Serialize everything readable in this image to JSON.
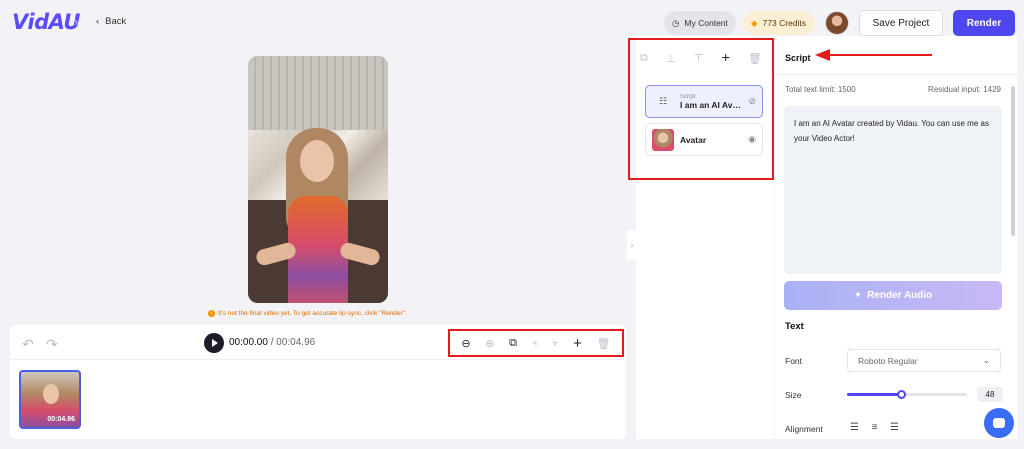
{
  "header": {
    "logo": "VidAU",
    "back_label": "Back",
    "my_content": "My Content",
    "credits": "773 Credits",
    "save_project": "Save Project",
    "render": "Render"
  },
  "preview": {
    "notice": "It's not the final video yet, To get accurate lip-sync, click \"Render\"."
  },
  "timeline": {
    "current_time": "00:00.00",
    "separator": " / ",
    "total_time": "00:04.96",
    "clip_duration": "00:04.96",
    "tools": [
      "zoom-out",
      "zoom-in",
      "copy",
      "split-left",
      "split-right",
      "add",
      "delete"
    ]
  },
  "layers": {
    "items": [
      {
        "type_label": "Script",
        "name": "I am an AI Ava...",
        "icon": "script-icon",
        "visibility": "hidden-eye-icon",
        "selected": true
      },
      {
        "type_label": "",
        "name": "Avatar",
        "icon": "avatar-thumb",
        "visibility": "eye-icon",
        "selected": false
      }
    ]
  },
  "script_panel": {
    "title": "Script",
    "total_limit": "Total text limit: 1500",
    "residual": "Residual input: 1429",
    "script_text": "I am an AI Avatar created by Vidau. You can use me as your Video Actor!",
    "render_audio": "Render Audio",
    "text_section": "Text",
    "font_label": "Font",
    "font_value": "Roboto Regular",
    "size_label": "Size",
    "size_value": "48",
    "size_fraction": 0.45,
    "alignment_label": "Alignment"
  },
  "colors": {
    "accent": "#4f46f0",
    "annotation_red": "#e51b1b",
    "notice_orange": "#e06a00"
  }
}
